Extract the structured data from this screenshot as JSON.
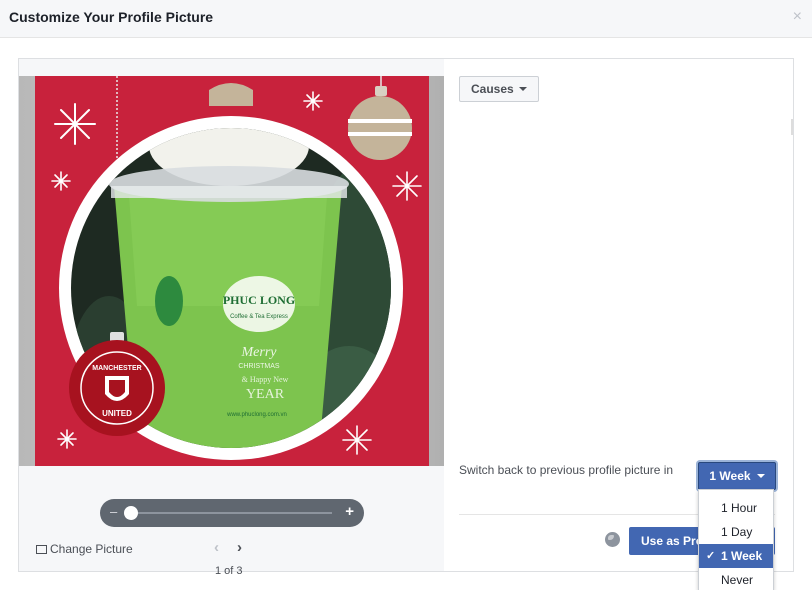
{
  "dialog": {
    "title": "Customize Your Profile Picture",
    "close_glyph": "×"
  },
  "editor": {
    "zoom_minus": "–",
    "zoom_plus": "+",
    "zoom_level": 0.0,
    "change_picture_label": "Change Picture",
    "prev_glyph": "‹",
    "next_glyph": "›",
    "pager_text": "1 of 3",
    "frame": {
      "background_color": "#c8223c",
      "badge_text_top": "MANCHESTER",
      "badge_text_bottom": "UNITED",
      "cup_brand": "PHUC LONG",
      "cup_subtitle": "Coffee & Tea Express",
      "cup_greeting_1": "Merry",
      "cup_greeting_2": "CHRISTMAS",
      "cup_greeting_3": "& Happy New",
      "cup_greeting_4": "YEAR",
      "cup_url": "www.phuclong.com.vn"
    }
  },
  "right": {
    "causes_label": "Causes",
    "switch_back_label": "Switch back to previous profile picture in",
    "duration_selected": "1 Week",
    "use_button_label": "Use as Profile Picture",
    "duration_options": [
      {
        "label": "1 Hour",
        "selected": false
      },
      {
        "label": "1 Day",
        "selected": false
      },
      {
        "label": "1 Week",
        "selected": true
      },
      {
        "label": "Never",
        "selected": false
      }
    ],
    "check_glyph": "✓"
  },
  "colors": {
    "brand_blue": "#4267b2",
    "frame_red": "#c8223c",
    "drink_green": "#7dc44e"
  }
}
